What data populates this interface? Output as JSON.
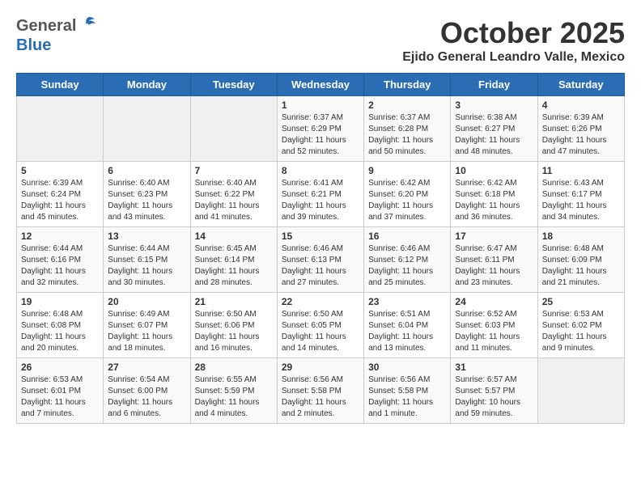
{
  "header": {
    "logo_general": "General",
    "logo_blue": "Blue",
    "month_title": "October 2025",
    "location": "Ejido General Leandro Valle, Mexico"
  },
  "weekdays": [
    "Sunday",
    "Monday",
    "Tuesday",
    "Wednesday",
    "Thursday",
    "Friday",
    "Saturday"
  ],
  "weeks": [
    [
      {
        "day": "",
        "content": ""
      },
      {
        "day": "",
        "content": ""
      },
      {
        "day": "",
        "content": ""
      },
      {
        "day": "1",
        "content": "Sunrise: 6:37 AM\nSunset: 6:29 PM\nDaylight: 11 hours and 52 minutes."
      },
      {
        "day": "2",
        "content": "Sunrise: 6:37 AM\nSunset: 6:28 PM\nDaylight: 11 hours and 50 minutes."
      },
      {
        "day": "3",
        "content": "Sunrise: 6:38 AM\nSunset: 6:27 PM\nDaylight: 11 hours and 48 minutes."
      },
      {
        "day": "4",
        "content": "Sunrise: 6:39 AM\nSunset: 6:26 PM\nDaylight: 11 hours and 47 minutes."
      }
    ],
    [
      {
        "day": "5",
        "content": "Sunrise: 6:39 AM\nSunset: 6:24 PM\nDaylight: 11 hours and 45 minutes."
      },
      {
        "day": "6",
        "content": "Sunrise: 6:40 AM\nSunset: 6:23 PM\nDaylight: 11 hours and 43 minutes."
      },
      {
        "day": "7",
        "content": "Sunrise: 6:40 AM\nSunset: 6:22 PM\nDaylight: 11 hours and 41 minutes."
      },
      {
        "day": "8",
        "content": "Sunrise: 6:41 AM\nSunset: 6:21 PM\nDaylight: 11 hours and 39 minutes."
      },
      {
        "day": "9",
        "content": "Sunrise: 6:42 AM\nSunset: 6:20 PM\nDaylight: 11 hours and 37 minutes."
      },
      {
        "day": "10",
        "content": "Sunrise: 6:42 AM\nSunset: 6:18 PM\nDaylight: 11 hours and 36 minutes."
      },
      {
        "day": "11",
        "content": "Sunrise: 6:43 AM\nSunset: 6:17 PM\nDaylight: 11 hours and 34 minutes."
      }
    ],
    [
      {
        "day": "12",
        "content": "Sunrise: 6:44 AM\nSunset: 6:16 PM\nDaylight: 11 hours and 32 minutes."
      },
      {
        "day": "13",
        "content": "Sunrise: 6:44 AM\nSunset: 6:15 PM\nDaylight: 11 hours and 30 minutes."
      },
      {
        "day": "14",
        "content": "Sunrise: 6:45 AM\nSunset: 6:14 PM\nDaylight: 11 hours and 28 minutes."
      },
      {
        "day": "15",
        "content": "Sunrise: 6:46 AM\nSunset: 6:13 PM\nDaylight: 11 hours and 27 minutes."
      },
      {
        "day": "16",
        "content": "Sunrise: 6:46 AM\nSunset: 6:12 PM\nDaylight: 11 hours and 25 minutes."
      },
      {
        "day": "17",
        "content": "Sunrise: 6:47 AM\nSunset: 6:11 PM\nDaylight: 11 hours and 23 minutes."
      },
      {
        "day": "18",
        "content": "Sunrise: 6:48 AM\nSunset: 6:09 PM\nDaylight: 11 hours and 21 minutes."
      }
    ],
    [
      {
        "day": "19",
        "content": "Sunrise: 6:48 AM\nSunset: 6:08 PM\nDaylight: 11 hours and 20 minutes."
      },
      {
        "day": "20",
        "content": "Sunrise: 6:49 AM\nSunset: 6:07 PM\nDaylight: 11 hours and 18 minutes."
      },
      {
        "day": "21",
        "content": "Sunrise: 6:50 AM\nSunset: 6:06 PM\nDaylight: 11 hours and 16 minutes."
      },
      {
        "day": "22",
        "content": "Sunrise: 6:50 AM\nSunset: 6:05 PM\nDaylight: 11 hours and 14 minutes."
      },
      {
        "day": "23",
        "content": "Sunrise: 6:51 AM\nSunset: 6:04 PM\nDaylight: 11 hours and 13 minutes."
      },
      {
        "day": "24",
        "content": "Sunrise: 6:52 AM\nSunset: 6:03 PM\nDaylight: 11 hours and 11 minutes."
      },
      {
        "day": "25",
        "content": "Sunrise: 6:53 AM\nSunset: 6:02 PM\nDaylight: 11 hours and 9 minutes."
      }
    ],
    [
      {
        "day": "26",
        "content": "Sunrise: 6:53 AM\nSunset: 6:01 PM\nDaylight: 11 hours and 7 minutes."
      },
      {
        "day": "27",
        "content": "Sunrise: 6:54 AM\nSunset: 6:00 PM\nDaylight: 11 hours and 6 minutes."
      },
      {
        "day": "28",
        "content": "Sunrise: 6:55 AM\nSunset: 5:59 PM\nDaylight: 11 hours and 4 minutes."
      },
      {
        "day": "29",
        "content": "Sunrise: 6:56 AM\nSunset: 5:58 PM\nDaylight: 11 hours and 2 minutes."
      },
      {
        "day": "30",
        "content": "Sunrise: 6:56 AM\nSunset: 5:58 PM\nDaylight: 11 hours and 1 minute."
      },
      {
        "day": "31",
        "content": "Sunrise: 6:57 AM\nSunset: 5:57 PM\nDaylight: 10 hours and 59 minutes."
      },
      {
        "day": "",
        "content": ""
      }
    ]
  ]
}
